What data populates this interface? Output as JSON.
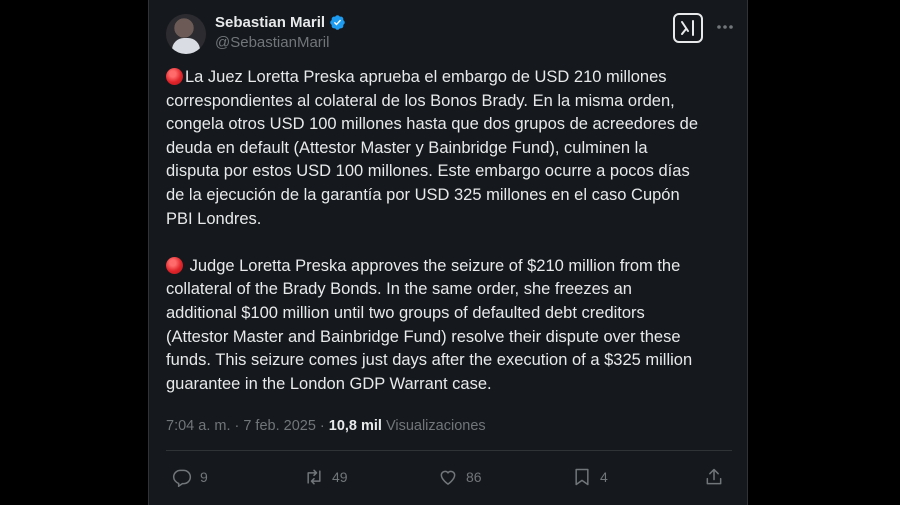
{
  "author": {
    "display_name": "Sebastian Maril",
    "handle": "@SebastianMaril",
    "verified_icon": "verified-badge-icon",
    "accent_color": "#1d9bf0"
  },
  "tweet": {
    "paragraph_es": "La Juez Loretta Preska aprueba el embargo de USD 210 millones\ncorrespondientes al colateral de los Bonos Brady. En la misma orden,\ncongela otros USD 100 millones hasta que dos grupos de acreedores de\ndeuda en default (Attestor Master y Bainbridge Fund), culminen la\ndisputa por estos USD 100 millones. Este embargo ocurre a pocos días\nde la ejecución de la garantía por USD 325 millones en el caso Cupón\nPBI Londres.",
    "paragraph_en": "Judge Loretta Preska approves the seizure of $210 million from the\ncollateral of the Brady Bonds. In the same order, she freezes an\nadditional $100 million until two groups of defaulted debt creditors\n(Attestor Master and Bainbridge Fund) resolve their dispute over these\nfunds. This seizure comes just days after the execution of a $325 million\nguarantee in the London GDP Warrant case.",
    "emoji_icon": "red-circle-icon"
  },
  "meta": {
    "time": "7:04 a. m.",
    "separator": "·",
    "date": "7 feb. 2025",
    "views_count": "10,8 mil",
    "views_label": "Visualizaciones"
  },
  "actions": {
    "replies": "9",
    "reposts": "49",
    "likes": "86",
    "bookmarks": "4"
  }
}
